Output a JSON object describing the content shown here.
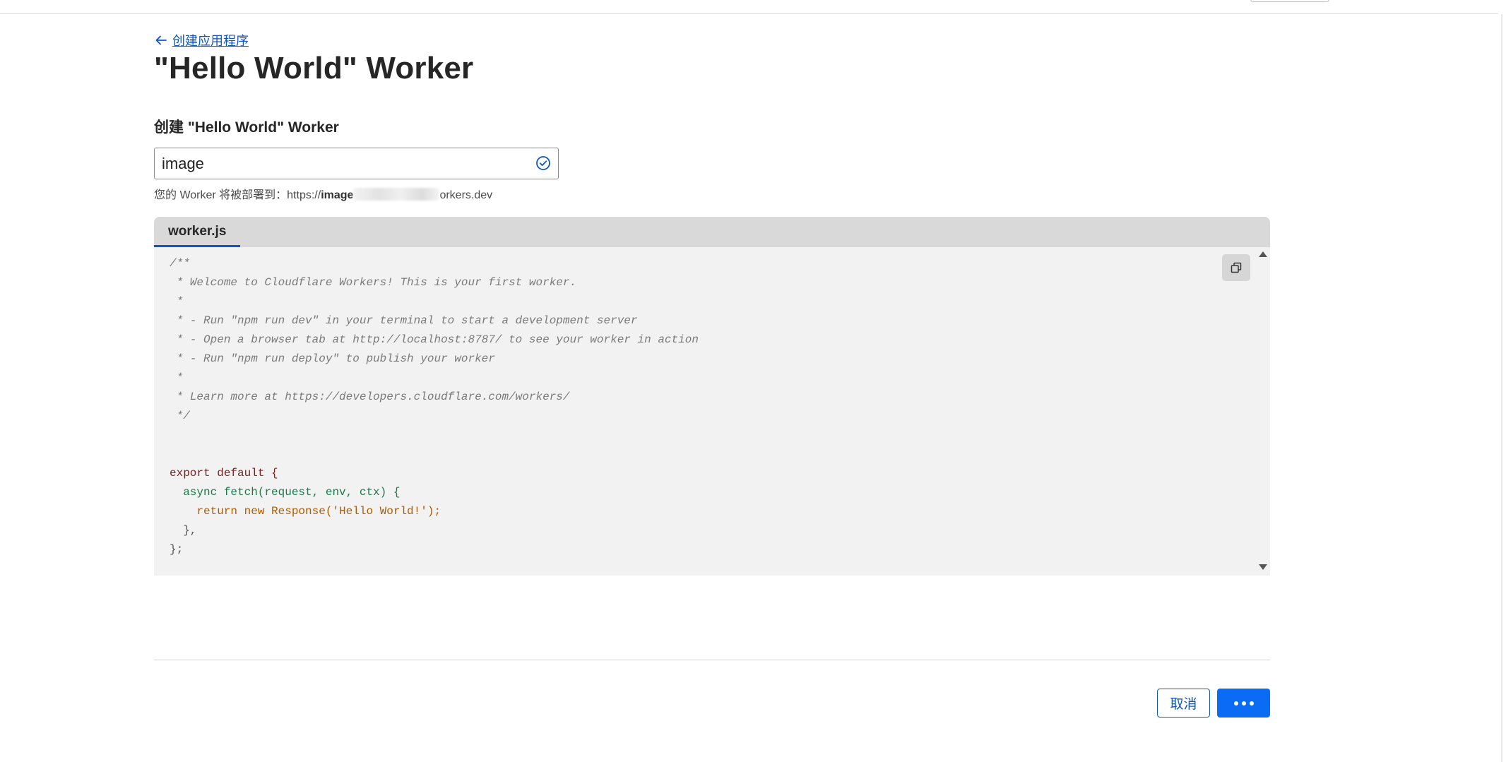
{
  "header": {
    "back_link_label": "创建应用程序",
    "page_title": "\"Hello World\" Worker"
  },
  "form": {
    "section_title": "创建 \"Hello World\" Worker",
    "worker_name_value": "image",
    "deploy_hint_prefix": "您的 Worker 将被部署到：https://",
    "deploy_hint_host_visible": "image",
    "deploy_hint_suffix": "orkers.dev"
  },
  "editor": {
    "tab_label": "worker.js",
    "code_lines": [
      "/**",
      " * Welcome to Cloudflare Workers! This is your first worker.",
      " *",
      " * - Run \"npm run dev\" in your terminal to start a development server",
      " * - Open a browser tab at http://localhost:8787/ to see your worker in action",
      " * - Run \"npm run deploy\" to publish your worker",
      " *",
      " * Learn more at https://developers.cloudflare.com/workers/",
      " */",
      "",
      "",
      "export default {",
      "  async fetch(request, env, ctx) {",
      "    return new Response('Hello World!');",
      "  },",
      "};"
    ]
  },
  "actions": {
    "cancel_label": "取消",
    "deploy_icon": "more-dots-icon"
  },
  "icons": {
    "back": "arrow-left-icon",
    "valid": "check-circle-icon",
    "copy": "copy-icon"
  },
  "colors": {
    "accent": "#0f56c2",
    "primary_button": "#0a6cf5",
    "editor_bg": "#f2f2f2",
    "tab_bar_bg": "#d9d9d9"
  }
}
